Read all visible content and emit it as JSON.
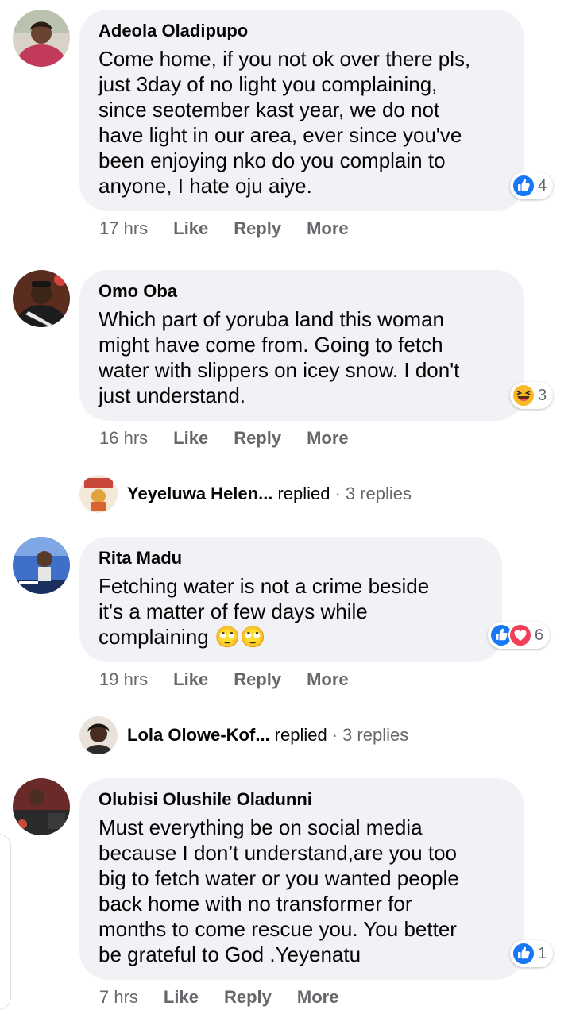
{
  "colors": {
    "bubble": "#f0f2f5",
    "secondary_text": "#65676b",
    "like_blue": "#1877f2",
    "love_red": "#f33e58",
    "haha_yellow": "#f7b928"
  },
  "comments": [
    {
      "author": "Adeola Oladipupo",
      "text": "Come home, if you not ok over there pls,\njust 3day of no light you complaining,\nsince seotember kast year, we do not\nhave light in our area, ever since you've\nbeen enjoying nko do you complain to\nanyone, I hate oju aiye.",
      "reactions": {
        "icons": [
          "like-icon"
        ],
        "count": "4"
      },
      "time": "17 hrs",
      "like_label": "Like",
      "reply_label": "Reply",
      "more_label": "More"
    },
    {
      "author": "Omo Oba",
      "text": "Which part of yoruba land this woman\nmight have come from. Going to fetch\nwater with slippers on icey snow. I don't\njust understand.",
      "reactions": {
        "icons": [
          "haha-icon"
        ],
        "count": "3"
      },
      "time": "16 hrs",
      "like_label": "Like",
      "reply_label": "Reply",
      "more_label": "More",
      "replies": {
        "name": "Yeyeluwa Helen...",
        "verb": "replied",
        "separator": "·",
        "count": "3 replies"
      }
    },
    {
      "author": "Rita Madu",
      "text": "Fetching water is not a crime beside\nit's a matter of few days while\ncomplaining",
      "emoji": "🙄🙄",
      "reactions": {
        "icons": [
          "like-icon",
          "love-icon"
        ],
        "count": "6"
      },
      "time": "19 hrs",
      "like_label": "Like",
      "reply_label": "Reply",
      "more_label": "More",
      "replies": {
        "name": "Lola Olowe-Kof...",
        "verb": "replied",
        "separator": "·",
        "count": "3 replies"
      }
    },
    {
      "author": "Olubisi Olushile Oladunni",
      "text": "Must everything be on social media\nbecause I don’t understand,are you too\nbig to fetch water or you wanted people\nback home with no transformer for\nmonths to come rescue you. You better\nbe grateful to God .Yeyenatu",
      "reactions": {
        "icons": [
          "like-icon"
        ],
        "count": "1"
      },
      "time": "7 hrs",
      "like_label": "Like",
      "reply_label": "Reply",
      "more_label": "More"
    }
  ]
}
